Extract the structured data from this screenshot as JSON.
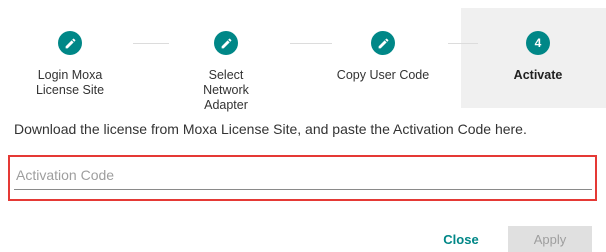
{
  "stepper": {
    "steps": [
      {
        "icon": "pencil-icon",
        "number": "",
        "label": "Login Moxa License Site",
        "state": "done"
      },
      {
        "icon": "pencil-icon",
        "number": "",
        "label": "Select Network Adapter",
        "state": "done"
      },
      {
        "icon": "pencil-icon",
        "number": "",
        "label": "Copy User Code",
        "state": "done"
      },
      {
        "icon": "",
        "number": "4",
        "label": "Activate",
        "state": "active"
      }
    ]
  },
  "instructions": "Download the license from Moxa License Site, and paste the Activation Code here.",
  "activation_field": {
    "value": "",
    "placeholder": "Activation Code"
  },
  "actions": {
    "close_label": "Close",
    "apply_label": "Apply"
  },
  "colors": {
    "accent": "#008787",
    "highlight_border": "#e53935",
    "active_step_bg": "#f0f0f0"
  }
}
